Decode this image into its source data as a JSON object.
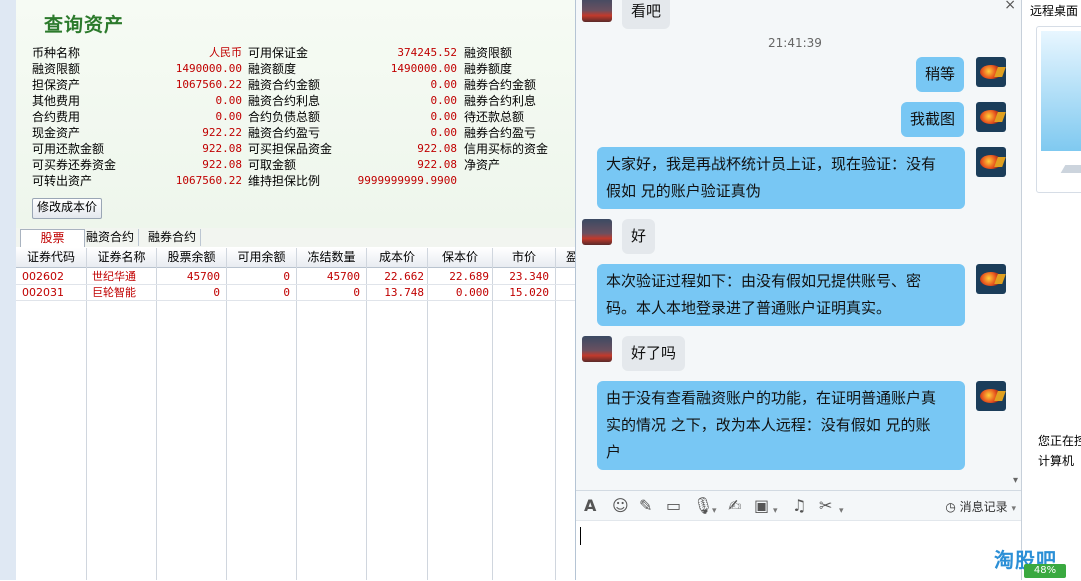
{
  "trade": {
    "title": "查询资产",
    "col1": [
      {
        "label": "币种名称",
        "value": "人民币"
      },
      {
        "label": "融资限额",
        "value": "1490000.00"
      },
      {
        "label": "担保资产",
        "value": "1067560.22"
      },
      {
        "label": "其他费用",
        "value": "0.00"
      },
      {
        "label": "合约费用",
        "value": "0.00"
      },
      {
        "label": "现金资产",
        "value": "922.22"
      },
      {
        "label": "可用还款金额",
        "value": "922.08"
      },
      {
        "label": "可买券还券资金",
        "value": "922.08"
      },
      {
        "label": "可转出资产",
        "value": "1067560.22"
      }
    ],
    "col2": [
      {
        "label": "可用保证金",
        "value": "374245.52"
      },
      {
        "label": "融资额度",
        "value": "1490000.00"
      },
      {
        "label": "融资合约金额",
        "value": "0.00"
      },
      {
        "label": "融资合约利息",
        "value": "0.00"
      },
      {
        "label": "合约负债总额",
        "value": "0.00"
      },
      {
        "label": "融资合约盈亏",
        "value": "0.00"
      },
      {
        "label": "可买担保品资金",
        "value": "922.08"
      },
      {
        "label": "可取金额",
        "value": "922.08"
      },
      {
        "label": "维持担保比例",
        "value": "9999999999.9900"
      }
    ],
    "col3": [
      "融资限额",
      "融券额度",
      "融券合约金额",
      "融券合约利息",
      "待还款总额",
      "融券合约盈亏",
      "信用买标的资金",
      "净资产"
    ],
    "modify_cost_button": "修改成本价",
    "tabs": [
      "股票",
      "融资合约",
      "融券合约"
    ],
    "columns": [
      "证券代码",
      "证券名称",
      "股票余额",
      "可用余额",
      "冻结数量",
      "成本价",
      "保本价",
      "市价",
      "盈"
    ],
    "rows": [
      [
        "002602",
        "世纪华通",
        "45700",
        "0",
        "45700",
        "22.662",
        "22.689",
        "23.340"
      ],
      [
        "002031",
        "巨轮智能",
        "0",
        "0",
        "0",
        "13.748",
        "0.000",
        "15.020"
      ]
    ]
  },
  "chat": {
    "close_glyph": "×",
    "time": "21:41:39",
    "messages": [
      {
        "side": "left",
        "text": "看吧"
      },
      {
        "side": "right",
        "text": "稍等"
      },
      {
        "side": "right",
        "text": "我截图"
      },
      {
        "side": "right",
        "lines": [
          "大家好，我是再战杯统计员上证，现在验证：没有",
          "假如 兄的账户验证真伪"
        ]
      },
      {
        "side": "left",
        "text": "好"
      },
      {
        "side": "right",
        "lines": [
          "本次验证过程如下：由没有假如兄提供账号、密",
          "码。本人本地登录进了普通账户证明真实。"
        ]
      },
      {
        "side": "left",
        "text": "好了吗"
      },
      {
        "side": "right",
        "lines": [
          "由于没有查看融资账户的功能，在证明普通账户真",
          "实的情况 之下，改为本人远程：没有假如 兄的账",
          "户"
        ]
      }
    ],
    "toolbar": {
      "font": "A",
      "emoji": "☺",
      "shake": "✎",
      "screenshot": "▭",
      "voice": "🎙",
      "edit": "✍",
      "image": "▣",
      "music": "♫",
      "cut": "✂",
      "dropdown": "▾",
      "history": "消息记录"
    },
    "scroll_arrow": "▾"
  },
  "remote": {
    "title": "远程桌面",
    "status_line1": "您正在控",
    "status_line2": "计算机"
  },
  "watermark": "淘股吧",
  "battery": "48%"
}
